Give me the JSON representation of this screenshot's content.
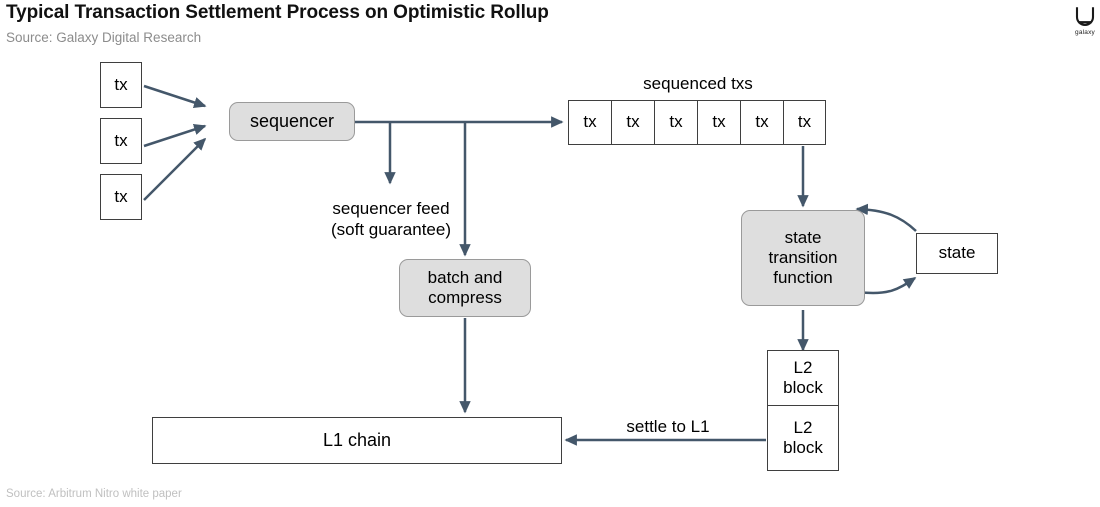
{
  "header": {
    "title": "Typical Transaction Settlement Process on Optimistic Rollup",
    "source": "Source: Galaxy Digital Research"
  },
  "footer": {
    "source": "Source: Arbitrum Nitro white paper"
  },
  "brand": {
    "wordmark": "galaxy",
    "mark_icon": "galaxy-logo-icon"
  },
  "colors": {
    "arrow": "#44576a",
    "box_border": "#3f3f3f",
    "round_fill": "#dedede",
    "round_border": "#9a9a9a",
    "title": "#111111",
    "source_text": "#8c8c8c",
    "footer_text": "#c0c0c0"
  },
  "diagram": {
    "incoming_txs": [
      {
        "label": "tx"
      },
      {
        "label": "tx"
      },
      {
        "label": "tx"
      }
    ],
    "sequencer": {
      "label": "sequencer"
    },
    "sequenced_txs": {
      "caption": "sequenced txs",
      "cells": [
        {
          "label": "tx"
        },
        {
          "label": "tx"
        },
        {
          "label": "tx"
        },
        {
          "label": "tx"
        },
        {
          "label": "tx"
        },
        {
          "label": "tx"
        }
      ]
    },
    "sequencer_feed": {
      "label": "sequencer feed\n(soft guarantee)"
    },
    "batch_and_compress": {
      "label": "batch and\ncompress"
    },
    "state_transition_function": {
      "label": "state\ntransition\nfunction"
    },
    "state": {
      "label": "state"
    },
    "l2_blocks": [
      {
        "label": "L2\nblock"
      },
      {
        "label": "L2\nblock"
      }
    ],
    "l1_chain": {
      "label": "L1 chain"
    },
    "settle_to_l1": {
      "label": "settle to L1"
    }
  }
}
